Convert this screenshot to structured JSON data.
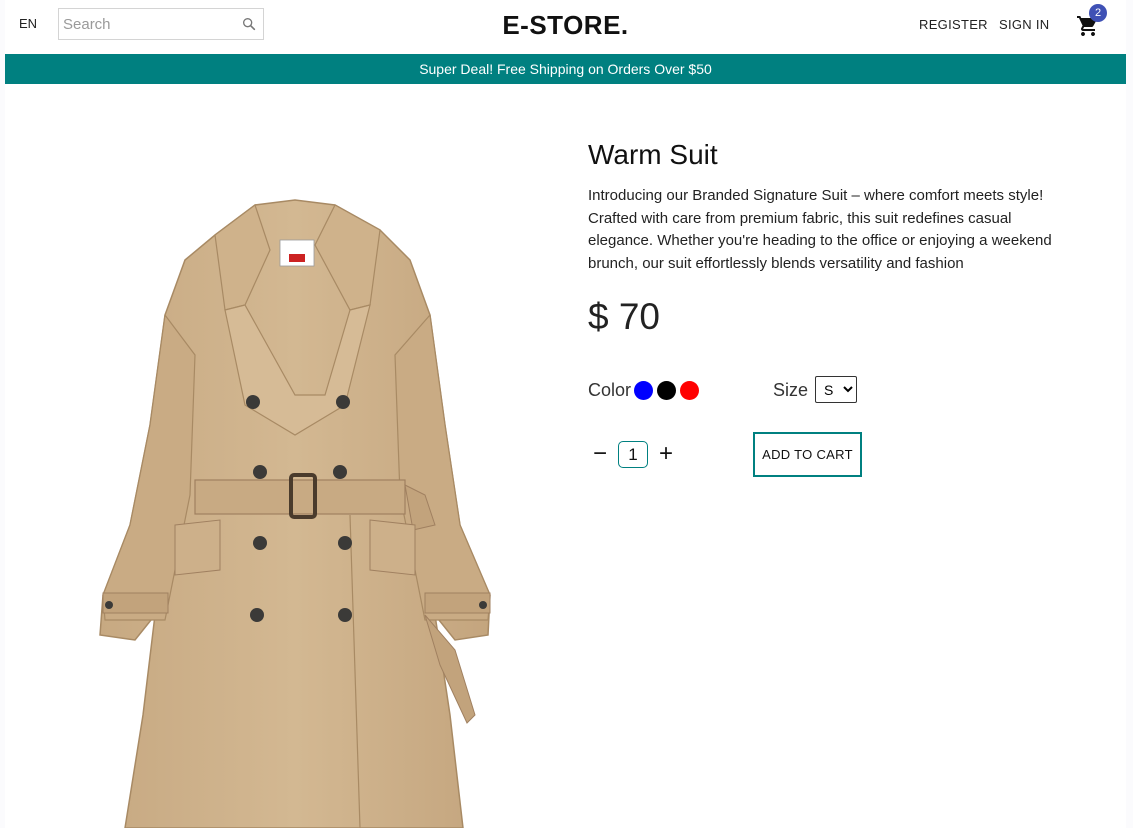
{
  "navbar": {
    "language": "EN",
    "search_placeholder": "Search",
    "logo": "E-STORE.",
    "register": "REGISTER",
    "sign_in": "SIGN IN",
    "cart_count": "2"
  },
  "announcement": "Super Deal! Free Shipping on Orders Over $50",
  "product": {
    "title": "Warm Suit",
    "description": "Introducing our Branded Signature Suit – where comfort meets style! Crafted with care from premium fabric, this suit redefines casual elegance. Whether you're heading to the office or enjoying a weekend brunch, our suit effortlessly blends versatility and fashion",
    "price": "$ 70",
    "color_label": "Color",
    "colors": [
      "#0000ff",
      "#000000",
      "#ff0000"
    ],
    "size_label": "Size",
    "size_selected": "S",
    "quantity": "1",
    "qty_minus": "−",
    "qty_plus": "+",
    "add_to_cart": "ADD TO CART"
  },
  "theme": {
    "accent": "#008080",
    "badge": "#3f51b5"
  }
}
